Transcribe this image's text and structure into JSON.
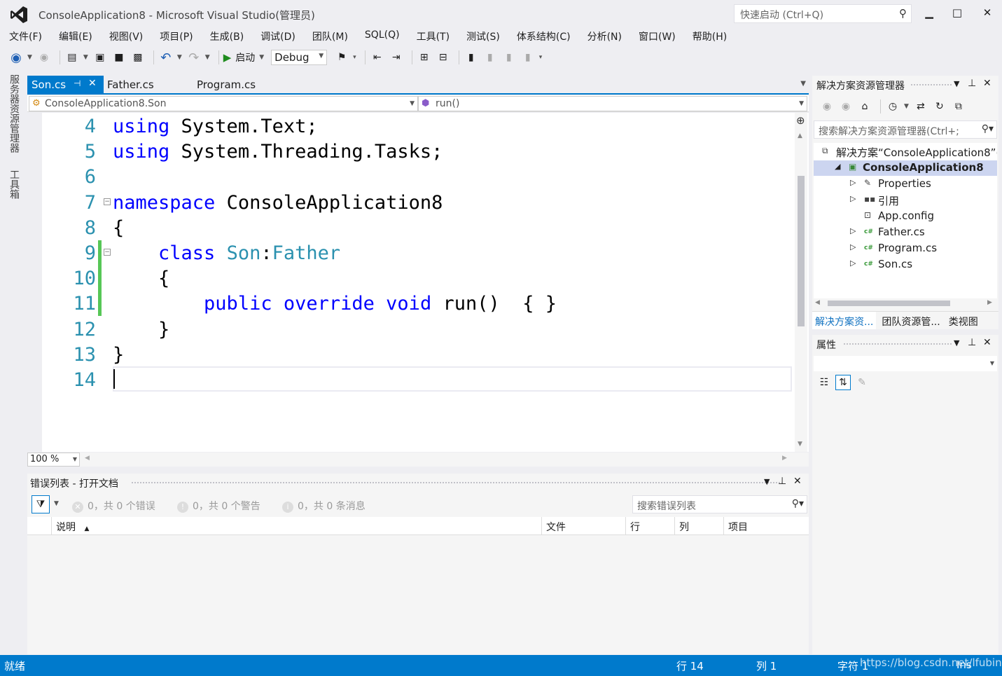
{
  "window": {
    "title": "ConsoleApplication8 - Microsoft Visual Studio(管理员)",
    "quick_launch_placeholder": "快速启动 (Ctrl+Q)"
  },
  "menu": [
    "文件(F)",
    "编辑(E)",
    "视图(V)",
    "项目(P)",
    "生成(B)",
    "调试(D)",
    "团队(M)",
    "SQL(Q)",
    "工具(T)",
    "测试(S)",
    "体系结构(C)",
    "分析(N)",
    "窗口(W)",
    "帮助(H)"
  ],
  "toolbar": {
    "start_label": "启动",
    "configuration": "Debug"
  },
  "left_tabs": [
    "服务器资源管理器",
    "工具箱"
  ],
  "doc_tabs": [
    {
      "label": "Son.cs",
      "active": true
    },
    {
      "label": "Father.cs",
      "active": false
    },
    {
      "label": "Program.cs",
      "active": false
    }
  ],
  "navbar": {
    "type_scope": "ConsoleApplication8.Son",
    "member_scope": "run()"
  },
  "editor": {
    "zoom": "100 %",
    "lines": [
      {
        "num": "4",
        "tokens": [
          {
            "t": "using",
            "c": "kw"
          },
          {
            "t": " System.Text;",
            "c": ""
          }
        ]
      },
      {
        "num": "5",
        "tokens": [
          {
            "t": "using",
            "c": "kw"
          },
          {
            "t": " System.Threading.Tasks;",
            "c": ""
          }
        ]
      },
      {
        "num": "6",
        "tokens": []
      },
      {
        "num": "7",
        "tokens": [
          {
            "t": "namespace",
            "c": "kw"
          },
          {
            "t": " ConsoleApplication8",
            "c": ""
          }
        ]
      },
      {
        "num": "8",
        "tokens": [
          {
            "t": "{",
            "c": ""
          }
        ]
      },
      {
        "num": "9",
        "tokens": [
          {
            "t": "    ",
            "c": ""
          },
          {
            "t": "class",
            "c": "kw"
          },
          {
            "t": " ",
            "c": ""
          },
          {
            "t": "Son",
            "c": "ty"
          },
          {
            "t": ":",
            "c": ""
          },
          {
            "t": "Father",
            "c": "ty"
          }
        ]
      },
      {
        "num": "10",
        "tokens": [
          {
            "t": "    {",
            "c": ""
          }
        ]
      },
      {
        "num": "11",
        "tokens": [
          {
            "t": "        ",
            "c": ""
          },
          {
            "t": "public",
            "c": "kw"
          },
          {
            "t": " ",
            "c": ""
          },
          {
            "t": "override",
            "c": "kw"
          },
          {
            "t": " ",
            "c": ""
          },
          {
            "t": "void",
            "c": "kw"
          },
          {
            "t": " run()  { }",
            "c": ""
          }
        ]
      },
      {
        "num": "12",
        "tokens": [
          {
            "t": "    }",
            "c": ""
          }
        ]
      },
      {
        "num": "13",
        "tokens": [
          {
            "t": "}",
            "c": ""
          }
        ]
      },
      {
        "num": "14",
        "tokens": []
      }
    ]
  },
  "error_list": {
    "title": "错误列表 - 打开文档",
    "errors": "0，共 0 个错误",
    "warnings": "0，共 0 个警告",
    "messages": "0，共 0 条消息",
    "search_placeholder": "搜索错误列表",
    "columns": [
      "说明",
      "文件",
      "行",
      "列",
      "项目"
    ]
  },
  "solution_explorer": {
    "title": "解决方案资源管理器",
    "search_placeholder": "搜索解决方案资源管理器(Ctrl+;",
    "tree": [
      {
        "label": "解决方案“ConsoleApplication8”(",
        "indent": 0,
        "expander": "",
        "icon": "solution-icon",
        "selected": false
      },
      {
        "label": "ConsoleApplication8",
        "indent": 1,
        "expander": "◢",
        "icon": "csharp-project-icon",
        "selected": true
      },
      {
        "label": "Properties",
        "indent": 2,
        "expander": "▷",
        "icon": "wrench-icon",
        "selected": false
      },
      {
        "label": "引用",
        "indent": 2,
        "expander": "▷",
        "icon": "references-icon",
        "selected": false
      },
      {
        "label": "App.config",
        "indent": 2,
        "expander": "",
        "icon": "config-file-icon",
        "selected": false
      },
      {
        "label": "Father.cs",
        "indent": 2,
        "expander": "▷",
        "icon": "csharp-file-icon",
        "selected": false
      },
      {
        "label": "Program.cs",
        "indent": 2,
        "expander": "▷",
        "icon": "csharp-file-icon",
        "selected": false
      },
      {
        "label": "Son.cs",
        "indent": 2,
        "expander": "▷",
        "icon": "csharp-file-icon",
        "selected": false
      }
    ],
    "tabs": [
      {
        "label": "解决方案资...",
        "active": true
      },
      {
        "label": "团队资源管...",
        "active": false
      },
      {
        "label": "类视图",
        "active": false
      }
    ]
  },
  "properties": {
    "title": "属性"
  },
  "status": {
    "ready": "就绪",
    "line": "行 14",
    "col": "列 1",
    "char": "字符 1",
    "ins": "Ins"
  },
  "watermark": "https://blog.csdn.net/lfubing",
  "colors": {
    "accent": "#007acc",
    "keyword": "#0000ff",
    "type": "#2b91af",
    "change_bar": "#57c757"
  }
}
